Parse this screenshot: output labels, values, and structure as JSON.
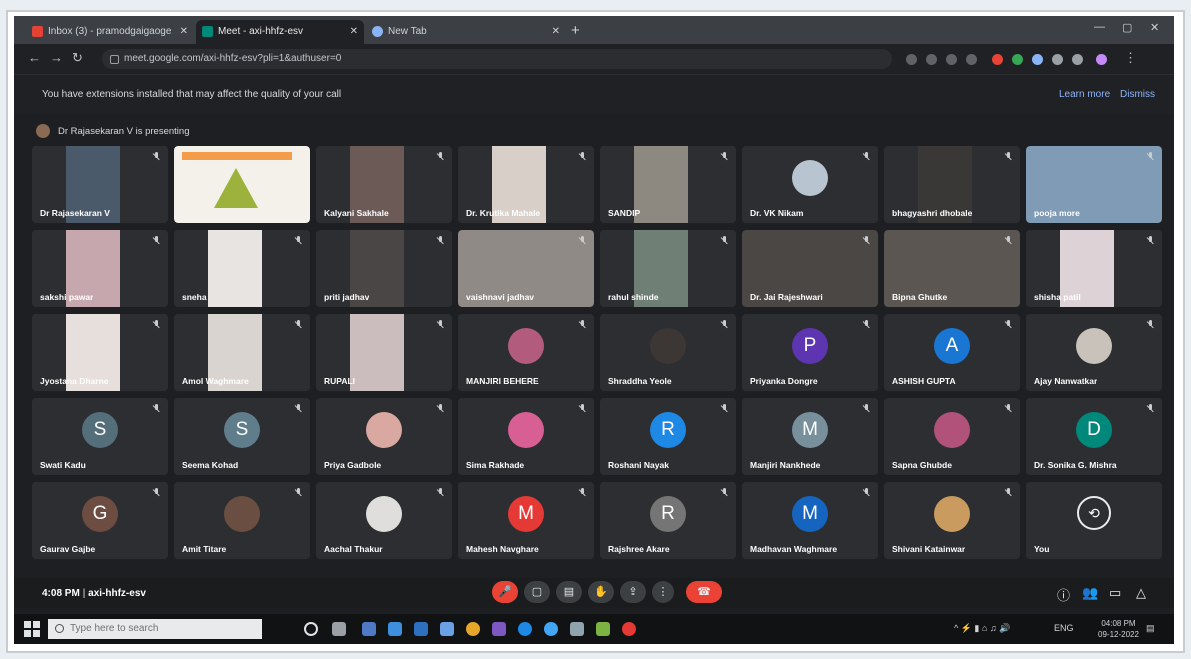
{
  "browser": {
    "tabs": [
      {
        "label": "Inbox (3) - pramodgaigaoge",
        "icon_color": "#e34234"
      },
      {
        "label": "Meet - axi-hhfz-esv",
        "icon_color": "#00897b"
      },
      {
        "label": "New Tab",
        "icon_color": "#8ab4f8"
      }
    ],
    "url": "meet.google.com/axi-hhfz-esv?pli=1&authuser=0"
  },
  "banner": {
    "message": "You have extensions installed that may affect the quality of your call",
    "learn_more": "Learn more",
    "dismiss": "Dismiss"
  },
  "presenting": "Dr Rajasekaran V is presenting",
  "participants": [
    {
      "name": "Dr Rajasekaran V",
      "type": "cam",
      "color": "#4a5a6a"
    },
    {
      "name": "",
      "type": "presentation",
      "color": "#f3f1ea"
    },
    {
      "name": "Kalyani Sakhale",
      "type": "cam",
      "color": "#6b5a55"
    },
    {
      "name": "Dr. Krutika Mahale",
      "type": "cam",
      "color": "#d8cfc8"
    },
    {
      "name": "SANDIP",
      "type": "cam",
      "color": "#8d8880"
    },
    {
      "name": "Dr. VK Nikam",
      "type": "photo",
      "color": "#b8c4cf"
    },
    {
      "name": "bhagyashri dhobale",
      "type": "cam",
      "color": "#3a3836"
    },
    {
      "name": "pooja more",
      "type": "widecam",
      "color": "#7f9bb5"
    },
    {
      "name": "sakshi pawar",
      "type": "cam",
      "color": "#c7a7ae"
    },
    {
      "name": "sneha",
      "type": "cam",
      "color": "#e8e4e2"
    },
    {
      "name": "priti jadhav",
      "type": "cam",
      "color": "#4b4646"
    },
    {
      "name": "vaishnavi jadhav",
      "type": "widecam",
      "color": "#8f8a86"
    },
    {
      "name": "rahul shinde",
      "type": "cam",
      "color": "#6f7f76"
    },
    {
      "name": "Dr. Jai Rajeshwari",
      "type": "widecam",
      "color": "#4a4744"
    },
    {
      "name": "Bipna Ghutke",
      "type": "widecam",
      "color": "#5b5652"
    },
    {
      "name": "shisha patil",
      "type": "cam",
      "color": "#ddd3d6"
    },
    {
      "name": "Jyostana Dharne",
      "type": "cam",
      "color": "#e6dfdc"
    },
    {
      "name": "Amol Waghmare",
      "type": "cam",
      "color": "#d9d4cf"
    },
    {
      "name": "RUPALI",
      "type": "cam",
      "color": "#cbbdbe"
    },
    {
      "name": "MANJIRI BEHERE",
      "type": "photo",
      "color": "#b35b7c"
    },
    {
      "name": "Shraddha Yeole",
      "type": "photo",
      "color": "#3c3734"
    },
    {
      "name": "Priyanka Dongre",
      "type": "letter",
      "letter": "P",
      "color": "#5e35b1"
    },
    {
      "name": "ASHISH GUPTA",
      "type": "letter",
      "letter": "A",
      "color": "#1976d2"
    },
    {
      "name": "Ajay Nanwatkar",
      "type": "photo",
      "color": "#c8c2ba"
    },
    {
      "name": "Swati Kadu",
      "type": "letter",
      "letter": "S",
      "color": "#546e7a"
    },
    {
      "name": "Seema Kohad",
      "type": "letter",
      "letter": "S",
      "color": "#607d8b"
    },
    {
      "name": "Priya Gadbole",
      "type": "photo",
      "color": "#d9a8a0"
    },
    {
      "name": "Sima Rakhade",
      "type": "photo",
      "color": "#d75f93"
    },
    {
      "name": "Roshani Nayak",
      "type": "letter",
      "letter": "R",
      "color": "#1e88e5"
    },
    {
      "name": "Manjiri Nankhede",
      "type": "letter",
      "letter": "M",
      "color": "#78909c"
    },
    {
      "name": "Sapna Ghubde",
      "type": "photo",
      "color": "#b0527a"
    },
    {
      "name": "Dr. Sonika G. Mishra",
      "type": "letter",
      "letter": "D",
      "color": "#00897b"
    },
    {
      "name": "Gaurav Gajbe",
      "type": "letter",
      "letter": "G",
      "color": "#6d4c41"
    },
    {
      "name": "Amit Titare",
      "type": "photo",
      "color": "#6a4e42"
    },
    {
      "name": "Aachal Thakur",
      "type": "photo",
      "color": "#e0dedd"
    },
    {
      "name": "Mahesh Navghare",
      "type": "letter",
      "letter": "M",
      "color": "#e53935"
    },
    {
      "name": "Rajshree Akare",
      "type": "letter",
      "letter": "R",
      "color": "#757575"
    },
    {
      "name": "Madhavan Waghmare",
      "type": "letter",
      "letter": "M",
      "color": "#1565c0"
    },
    {
      "name": "Shivani Katainwar",
      "type": "photo",
      "color": "#c99b5e"
    },
    {
      "name": "You",
      "type": "you",
      "color": "#2c2e31"
    }
  ],
  "meeting": {
    "time": "4:08 PM",
    "code": "axi-hhfz-esv"
  },
  "taskbar": {
    "search_placeholder": "Type here to search",
    "lang": "ENG",
    "clock_time": "04:08 PM",
    "clock_date": "09-12-2022"
  }
}
